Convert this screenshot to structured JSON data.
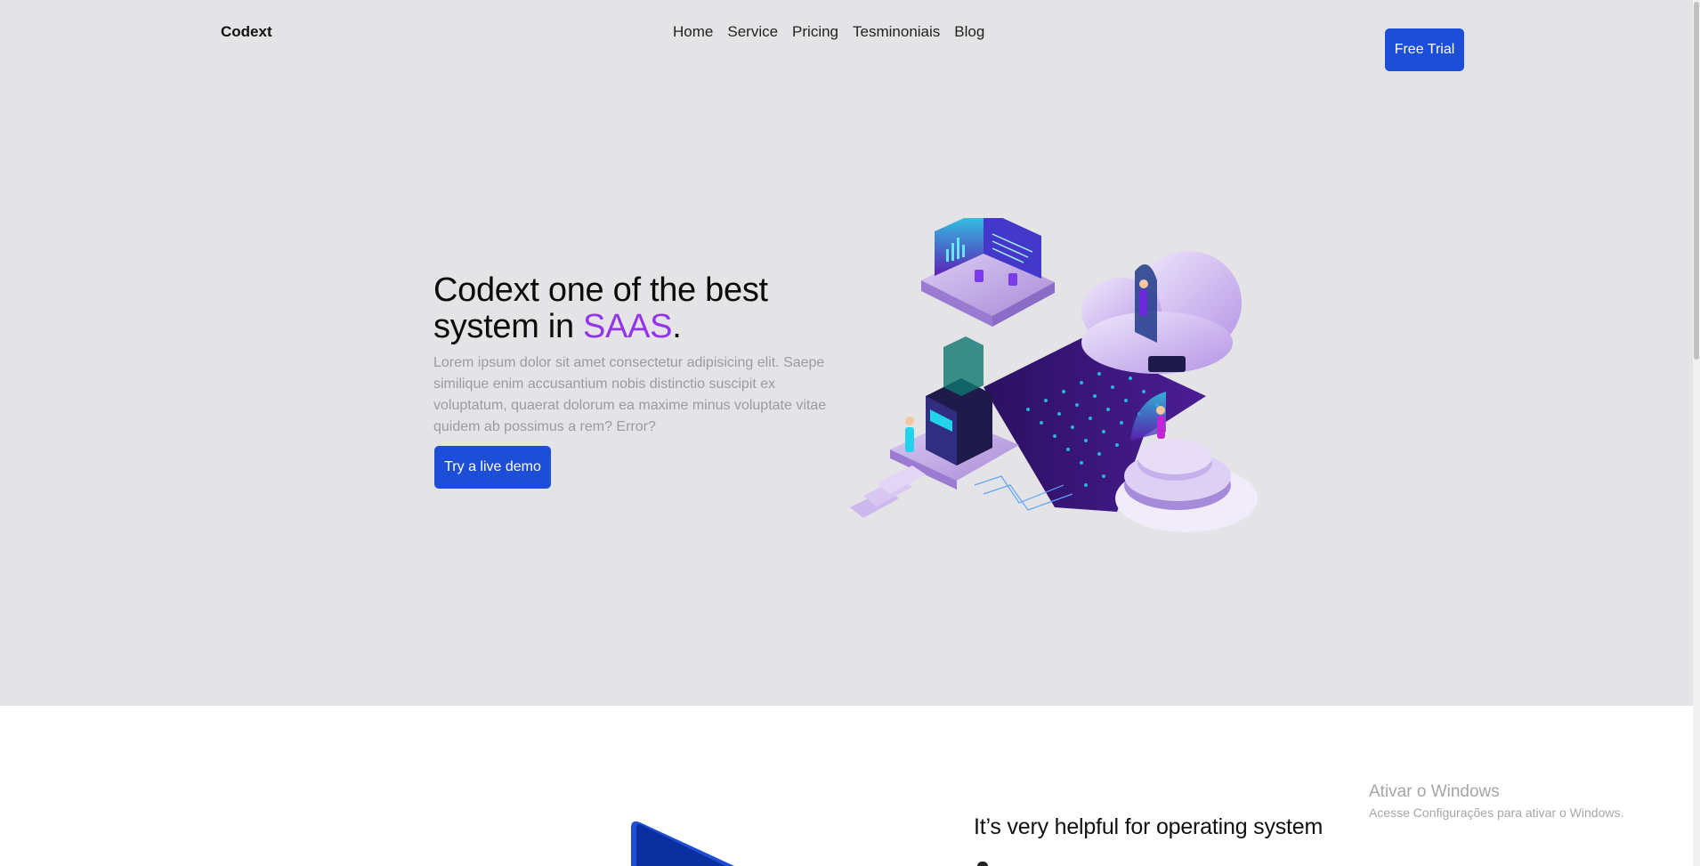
{
  "header": {
    "logo": "Codext",
    "nav": [
      "Home",
      "Service",
      "Pricing",
      "Tesminoniais",
      "Blog"
    ],
    "cta_label": "Free Trial"
  },
  "hero": {
    "title_part1": "Codext one of the best system in ",
    "title_accent": "SAAS",
    "title_end": ".",
    "description": "Lorem ipsum dolor sit amet consectetur adipisicing elit. Saepe similique enim accusantium nobis distinctio suscipit ex voluptatum, quaerat dolorum ea maxime minus voluptate vitae quidem ab possimus a rem? Error?",
    "button_label": "Try a live demo"
  },
  "section2": {
    "heading": "It’s very helpful for operating system"
  },
  "windows_watermark": {
    "title": "Ativar o Windows",
    "subtitle": "Acesse Configurações para ativar o Windows."
  },
  "colors": {
    "hero_bg": "#e4e4e7",
    "accent": "#9333ea",
    "button": "#1d4ed8"
  }
}
